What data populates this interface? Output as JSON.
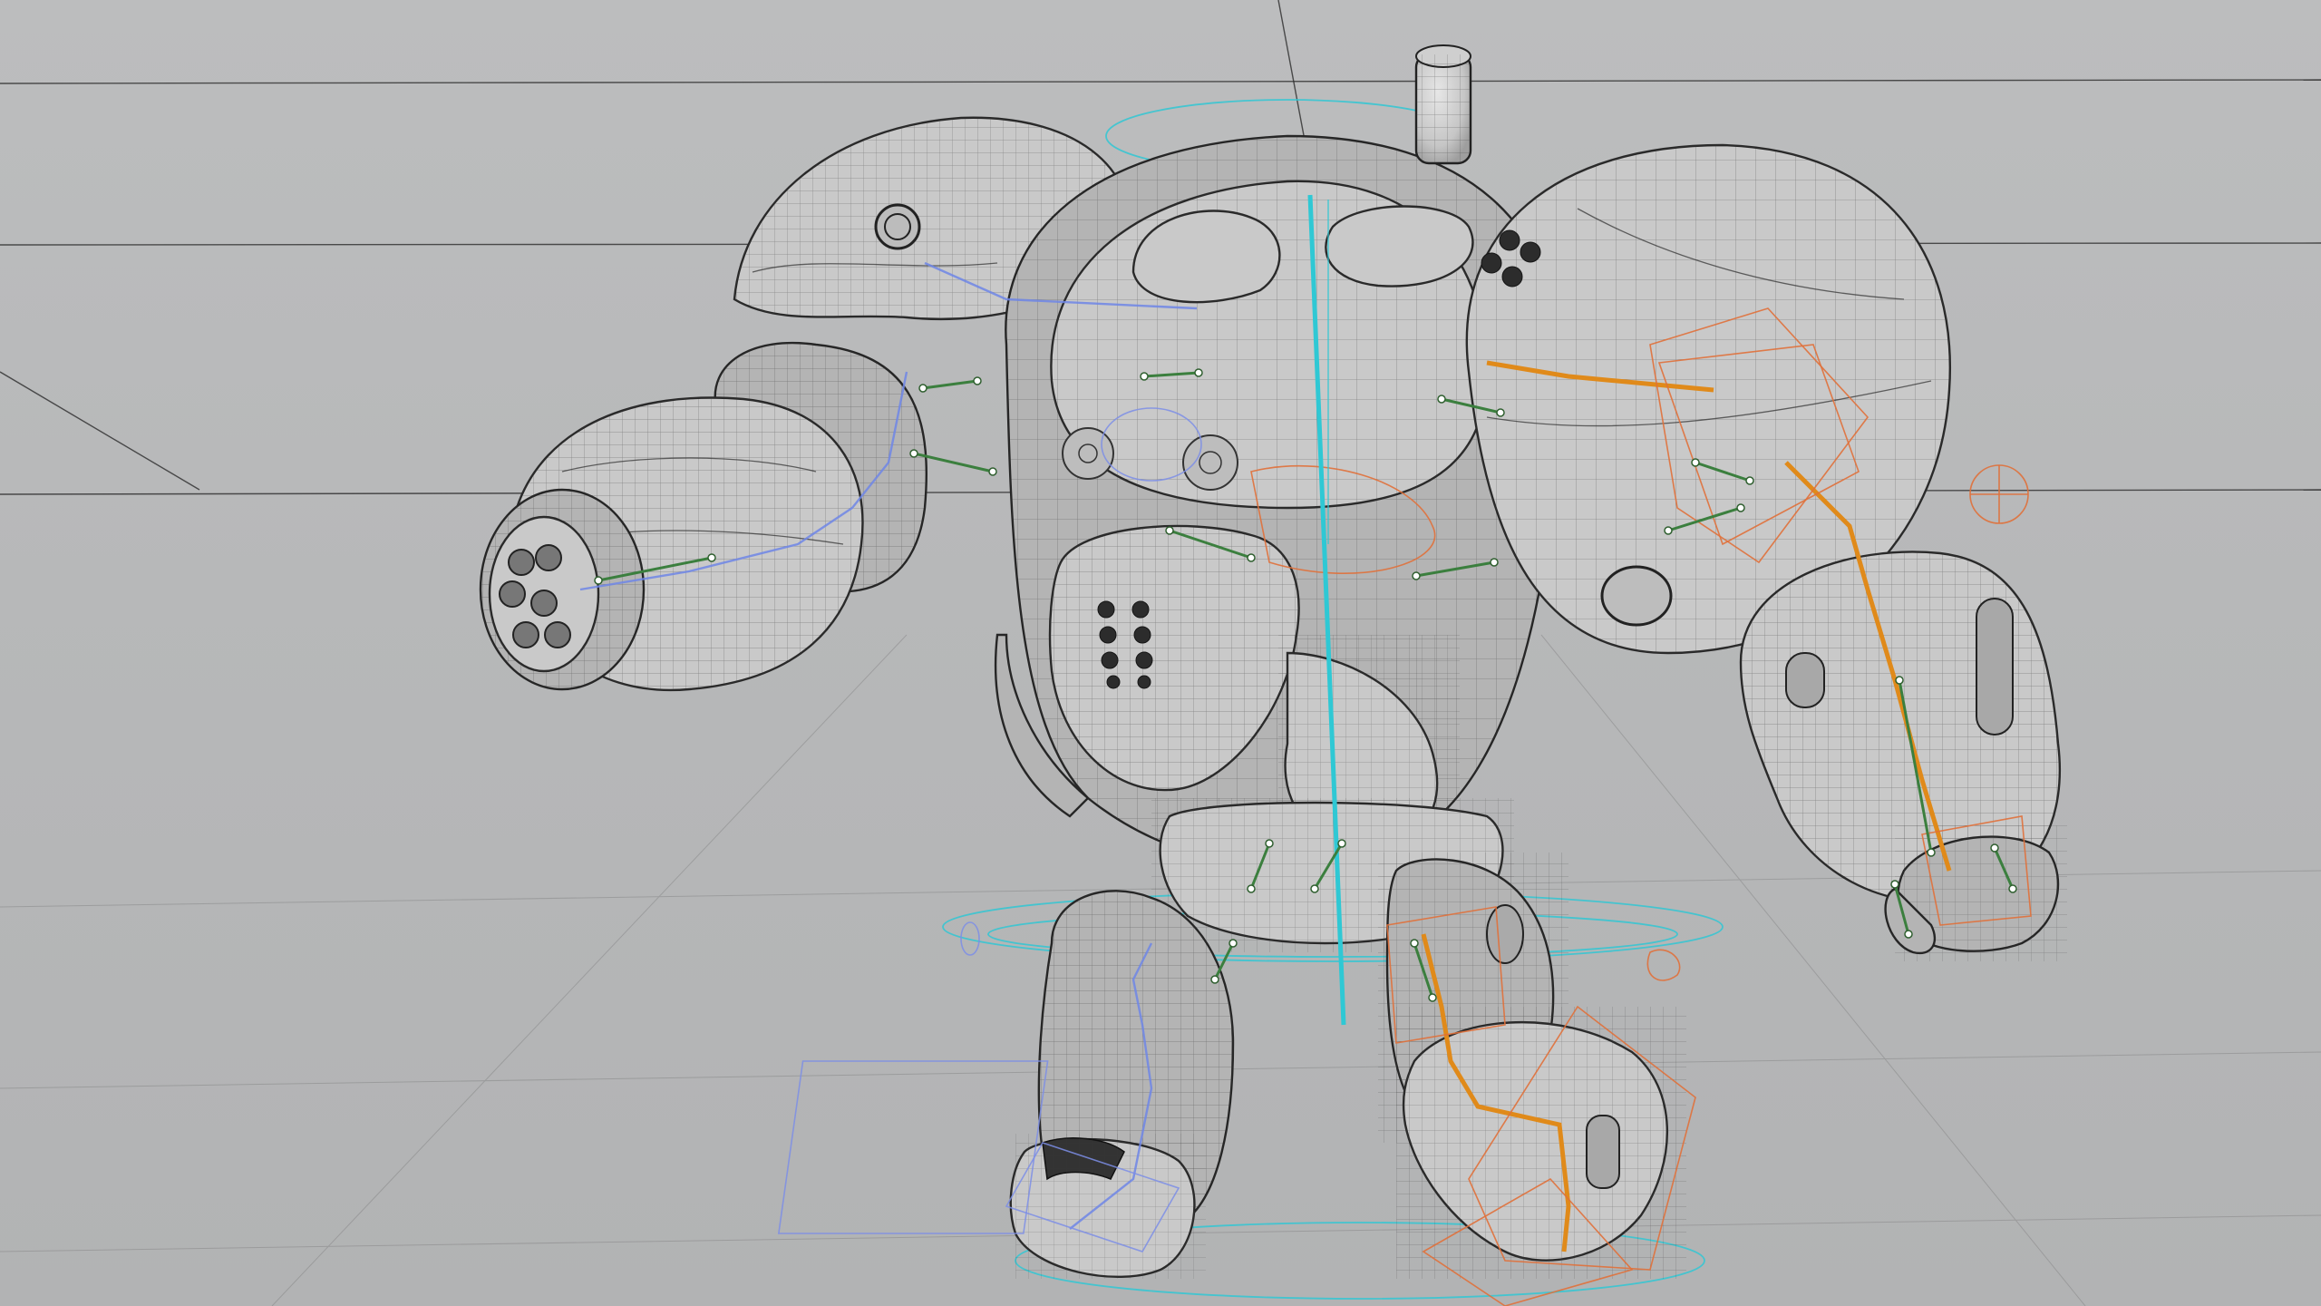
{
  "viewport": {
    "mode": "wireframe-on-shaded",
    "background_color": "#b7b8b9",
    "model": "mech-robot"
  },
  "colors": {
    "mesh_line": "#2a2a2a",
    "spine_bone": "#30c7d4",
    "ik_chain_right": "#e08a1a",
    "controller_right": "#e0703a",
    "ik_chain_left": "#6f86e6",
    "joint_bone": "#3b7f3e"
  },
  "icons": {
    "grid": "horizon-grid",
    "rig": "skeleton-bones"
  }
}
